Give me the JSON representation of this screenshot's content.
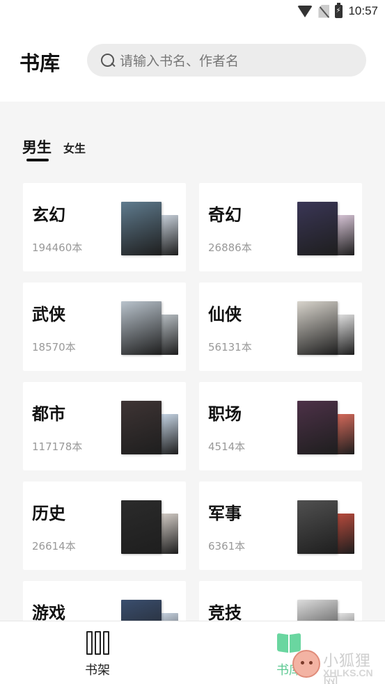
{
  "status_bar": {
    "time": "10:57"
  },
  "header": {
    "title": "书库"
  },
  "search": {
    "placeholder": "请输入书名、作者名"
  },
  "tabs": [
    {
      "label": "男生",
      "selected": true
    },
    {
      "label": "女生",
      "selected": false
    }
  ],
  "categories": [
    {
      "name": "玄幻",
      "count": "194460本",
      "cover_colors": [
        "#5f7b8e",
        "#c9d2dc"
      ]
    },
    {
      "name": "奇幻",
      "count": "26886本",
      "cover_colors": [
        "#3a3656",
        "#d9c6d8"
      ]
    },
    {
      "name": "武侠",
      "count": "18570本",
      "cover_colors": [
        "#b9c3cc",
        "#b8bfc4"
      ]
    },
    {
      "name": "仙侠",
      "count": "56131本",
      "cover_colors": [
        "#d8d4cc",
        "#e3e3e3"
      ]
    },
    {
      "name": "都市",
      "count": "117178本",
      "cover_colors": [
        "#3e3434",
        "#c7d6e6"
      ]
    },
    {
      "name": "职场",
      "count": "4514本",
      "cover_colors": [
        "#4d3148",
        "#d56a5b"
      ]
    },
    {
      "name": "历史",
      "count": "26614本",
      "cover_colors": [
        "#2b2b2b",
        "#d4cdc7"
      ]
    },
    {
      "name": "军事",
      "count": "6361本",
      "cover_colors": [
        "#505050",
        "#b84b3d"
      ]
    },
    {
      "name": "游戏",
      "count": "",
      "cover_colors": [
        "#3a4e6e",
        "#c8d4e2"
      ]
    },
    {
      "name": "竞技",
      "count": "",
      "cover_colors": [
        "#dcdcdc",
        "#e8e8e8"
      ]
    }
  ],
  "bottom_nav": {
    "shelf": {
      "label": "书架",
      "icon": "bookshelf-icon"
    },
    "library": {
      "label": "书库",
      "icon": "open-book-icon",
      "color": "#5cc992",
      "selected": true
    }
  },
  "watermark": {
    "cn": "小狐狸网",
    "en": "XHLKS.CN"
  }
}
